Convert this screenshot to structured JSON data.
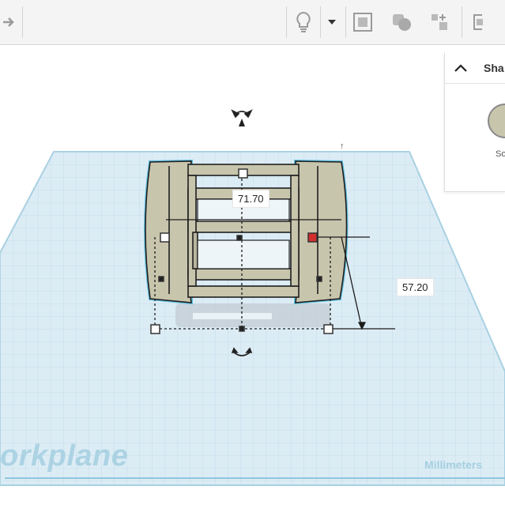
{
  "panel": {
    "title": "Sha",
    "swatch_label": "So"
  },
  "dimensions": {
    "width": "71.70",
    "height": "57.20"
  },
  "workplane": {
    "label": "orkplane",
    "units": "Millimeters"
  },
  "icons": [
    "arrow-right-icon",
    "lightbulb-icon",
    "chevron-down-icon",
    "group-icon",
    "ungroup-icon",
    "align-icon",
    "mirror-icon",
    "rotate-icon",
    "chevron-up-icon"
  ],
  "colors": {
    "workplane": "#dcecf5",
    "grid": "#bcdbe8",
    "shape": "#c8c5ad",
    "selection": "#5fc0e0",
    "handle_active": "#d32f2f"
  }
}
